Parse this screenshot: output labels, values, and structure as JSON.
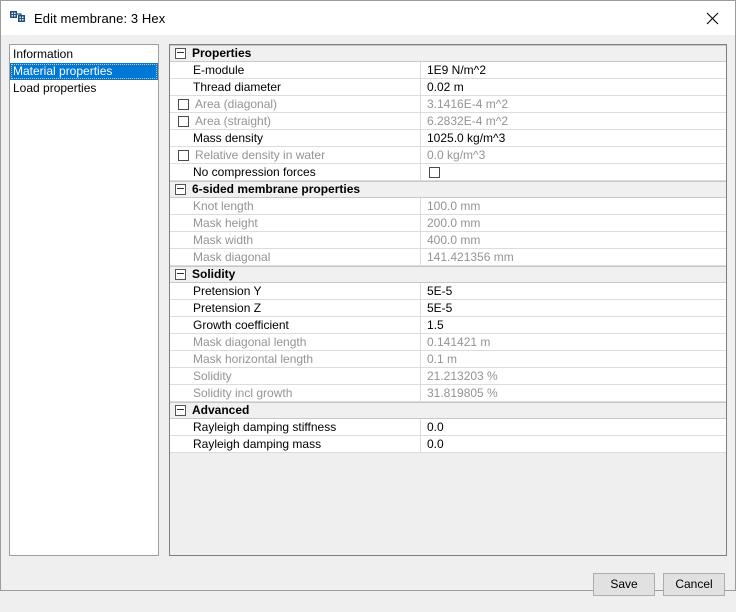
{
  "window": {
    "title": "Edit membrane: 3 Hex",
    "app_icon": "application-icon",
    "close_label": "×"
  },
  "sidebar": {
    "items": [
      {
        "label": "Information",
        "selected": false
      },
      {
        "label": "Material properties",
        "selected": true
      },
      {
        "label": "Load properties",
        "selected": false
      }
    ]
  },
  "grid": {
    "groups": [
      {
        "title": "Properties",
        "expanded": true,
        "rows": [
          {
            "label": "E-module",
            "value": "1E9 N/m^2",
            "disabled": false,
            "checkbox": "none"
          },
          {
            "label": "Thread diameter",
            "value": "0.02 m",
            "disabled": false,
            "checkbox": "none"
          },
          {
            "label": "Area (diagonal)",
            "value": "3.1416E-4 m^2",
            "disabled": true,
            "checkbox": "label"
          },
          {
            "label": "Area (straight)",
            "value": "6.2832E-4 m^2",
            "disabled": true,
            "checkbox": "label"
          },
          {
            "label": "Mass density",
            "value": "1025.0 kg/m^3",
            "disabled": false,
            "checkbox": "none"
          },
          {
            "label": "Relative density in water",
            "value": "0.0 kg/m^3",
            "disabled": true,
            "checkbox": "label"
          },
          {
            "label": "No compression forces",
            "value": "",
            "disabled": false,
            "checkbox": "value"
          }
        ]
      },
      {
        "title": "6-sided membrane properties",
        "expanded": true,
        "rows": [
          {
            "label": "Knot length",
            "value": "100.0 mm",
            "disabled": true,
            "checkbox": "none"
          },
          {
            "label": "Mask height",
            "value": "200.0 mm",
            "disabled": true,
            "checkbox": "none"
          },
          {
            "label": "Mask width",
            "value": "400.0 mm",
            "disabled": true,
            "checkbox": "none"
          },
          {
            "label": "Mask diagonal",
            "value": "141.421356 mm",
            "disabled": true,
            "checkbox": "none"
          }
        ]
      },
      {
        "title": "Solidity",
        "expanded": true,
        "rows": [
          {
            "label": "Pretension Y",
            "value": "5E-5",
            "disabled": false,
            "checkbox": "none"
          },
          {
            "label": "Pretension Z",
            "value": "5E-5",
            "disabled": false,
            "checkbox": "none"
          },
          {
            "label": "Growth coefficient",
            "value": "1.5",
            "disabled": false,
            "checkbox": "none"
          },
          {
            "label": "Mask diagonal length",
            "value": "0.141421 m",
            "disabled": true,
            "checkbox": "none"
          },
          {
            "label": "Mask horizontal length",
            "value": "0.1 m",
            "disabled": true,
            "checkbox": "none"
          },
          {
            "label": "Solidity",
            "value": "21.213203 %",
            "disabled": true,
            "checkbox": "none"
          },
          {
            "label": "Solidity incl growth",
            "value": "31.819805 %",
            "disabled": true,
            "checkbox": "none"
          }
        ]
      },
      {
        "title": "Advanced",
        "expanded": true,
        "rows": [
          {
            "label": "Rayleigh damping stiffness",
            "value": "0.0",
            "disabled": false,
            "checkbox": "none"
          },
          {
            "label": "Rayleigh damping mass",
            "value": "0.0",
            "disabled": false,
            "checkbox": "none"
          }
        ]
      }
    ]
  },
  "footer": {
    "save_label": "Save",
    "cancel_label": "Cancel"
  },
  "colors": {
    "selection_blue": "#0078d7",
    "group_header_bg": "#f0f0f0",
    "disabled_text": "#949494",
    "dialog_bg": "#efefef"
  }
}
